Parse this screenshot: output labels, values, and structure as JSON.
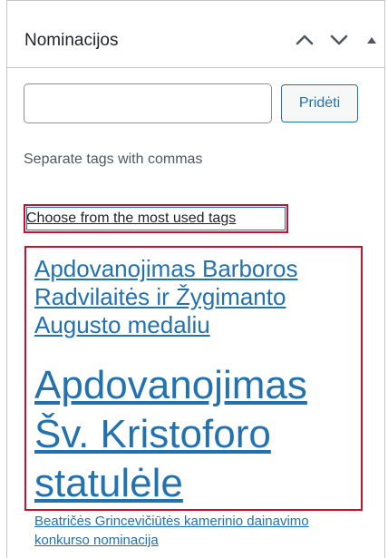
{
  "metabox": {
    "title": "Nominacijos",
    "icons": {
      "move_up": "chevron-up-icon",
      "move_down": "chevron-down-icon",
      "toggle": "triangle-up-icon"
    }
  },
  "tag_input": {
    "value": "",
    "placeholder": ""
  },
  "add_button": {
    "label": "Pridėti"
  },
  "howto": "Separate tags with commas",
  "most_used_link": "Choose from the most used tags",
  "tag_cloud": [
    "Apdovanojimas Barboros Radvilaitės ir Žygimanto Augusto medaliu",
    "Apdovanojimas Šv. Kristoforo statulėle",
    "Beatričės Grincevičiūtės kamerinio dainavimo konkurso nominacija"
  ],
  "colors": {
    "link": "#2271b1",
    "highlight": "#c8102e",
    "border": "#c3c4c7"
  }
}
